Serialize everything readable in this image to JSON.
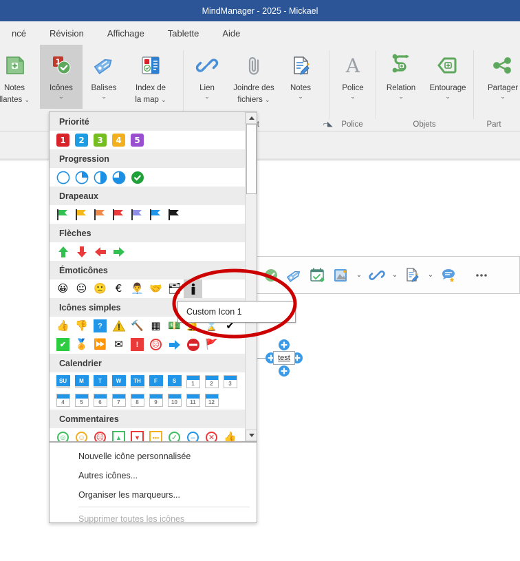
{
  "titlebar": {
    "title": "MindManager - 2025 - Mickael"
  },
  "tabs": [
    {
      "label": "ncé"
    },
    {
      "label": "Révision"
    },
    {
      "label": "Affichage"
    },
    {
      "label": "Tablette"
    },
    {
      "label": "Aide"
    }
  ],
  "ribbon": {
    "groups": [
      {
        "label": "e sujet",
        "buttons": [
          {
            "label": "Notes\nllantes",
            "icon": "floating-notes-icon",
            "chevron": true,
            "active": false
          },
          {
            "label": "Icônes",
            "icon": "icons-icon",
            "chevron": true,
            "active": true
          },
          {
            "label": "Balises",
            "icon": "tags-icon",
            "chevron": true,
            "active": false
          },
          {
            "label": "Index de\nla map",
            "icon": "map-index-icon",
            "chevron": true,
            "active": false
          },
          {
            "label": "Lien",
            "icon": "link-icon",
            "chevron": true,
            "active": false
          },
          {
            "label": "Joindre des\nfichiers",
            "icon": "attach-files-icon",
            "chevron": true,
            "active": false
          },
          {
            "label": "Notes",
            "icon": "notes-icon",
            "chevron": true,
            "active": false
          }
        ]
      },
      {
        "label": "Police",
        "buttons": [
          {
            "label": "Police",
            "icon": "font-icon",
            "chevron": true,
            "active": false
          }
        ]
      },
      {
        "label": "Objets",
        "buttons": [
          {
            "label": "Relation",
            "icon": "relation-icon",
            "chevron": true,
            "active": false
          },
          {
            "label": "Entourage",
            "icon": "boundary-icon",
            "chevron": true,
            "active": false
          }
        ]
      },
      {
        "label": "Part",
        "buttons": [
          {
            "label": "Partager",
            "icon": "share-icon",
            "chevron": true,
            "active": false
          }
        ]
      }
    ]
  },
  "icon_panel": {
    "sections": [
      {
        "heading": "Priorité",
        "rows": [
          [
            {
              "name": "priority-1",
              "kind": "num",
              "text": "1",
              "color": "#d8232a"
            },
            {
              "name": "priority-2",
              "kind": "num",
              "text": "2",
              "color": "#1b9ce3"
            },
            {
              "name": "priority-3",
              "kind": "num",
              "text": "3",
              "color": "#76bd22"
            },
            {
              "name": "priority-4",
              "kind": "num",
              "text": "4",
              "color": "#f2b01e"
            },
            {
              "name": "priority-5",
              "kind": "num",
              "text": "5",
              "color": "#9a4fd1"
            }
          ]
        ]
      },
      {
        "heading": "Progression",
        "rows": [
          [
            {
              "name": "progress-0",
              "kind": "pie",
              "pct": 0,
              "color": "#1b8fe3"
            },
            {
              "name": "progress-25",
              "kind": "pie",
              "pct": 25,
              "color": "#1b8fe3"
            },
            {
              "name": "progress-50",
              "kind": "pie",
              "pct": 50,
              "color": "#1b8fe3"
            },
            {
              "name": "progress-75",
              "kind": "pie",
              "pct": 75,
              "color": "#1b8fe3"
            },
            {
              "name": "progress-100",
              "kind": "check-circle",
              "color": "#1fa038"
            }
          ]
        ]
      },
      {
        "heading": "Drapeaux",
        "rows": [
          [
            {
              "name": "flag-green",
              "kind": "flag",
              "color": "#31c14e"
            },
            {
              "name": "flag-yellow",
              "kind": "flag",
              "color": "#f5b81b"
            },
            {
              "name": "flag-orange",
              "kind": "flag",
              "color": "#f08a4b"
            },
            {
              "name": "flag-red",
              "kind": "flag",
              "color": "#ea3a3a"
            },
            {
              "name": "flag-purple",
              "kind": "flag",
              "color": "#8f8fe8"
            },
            {
              "name": "flag-blue",
              "kind": "flag",
              "color": "#2196e8"
            },
            {
              "name": "flag-black",
              "kind": "flag",
              "color": "#1a1a1a"
            }
          ]
        ]
      },
      {
        "heading": "Flèches",
        "rows": [
          [
            {
              "name": "arrow-up",
              "kind": "arrow",
              "dir": "up",
              "color": "#31c14e"
            },
            {
              "name": "arrow-down",
              "kind": "arrow",
              "dir": "down",
              "color": "#ea3a3a"
            },
            {
              "name": "arrow-left",
              "kind": "arrow",
              "dir": "left",
              "color": "#ea3a3a"
            },
            {
              "name": "arrow-right",
              "kind": "arrow",
              "dir": "right",
              "color": "#31c14e"
            }
          ]
        ]
      },
      {
        "heading": "Émoticônes",
        "rows": [
          [
            {
              "name": "smiley-happy",
              "kind": "glyph",
              "text": "😀"
            },
            {
              "name": "smiley-neutral",
              "kind": "glyph",
              "text": "😐"
            },
            {
              "name": "smiley-sad",
              "kind": "glyph",
              "text": "🙁"
            },
            {
              "name": "euro-coin",
              "kind": "glyph",
              "text": "€"
            },
            {
              "name": "person-presenter",
              "kind": "glyph",
              "text": "👨‍💼"
            },
            {
              "name": "handshake-blue",
              "kind": "glyph",
              "text": "🤝"
            },
            {
              "name": "org-chart",
              "kind": "glyph",
              "text": "🗂"
            },
            {
              "name": "custom-icon-1",
              "kind": "person",
              "selected": true
            }
          ]
        ]
      },
      {
        "heading": "Icônes simples",
        "rows": [
          [
            {
              "name": "thumb-up",
              "kind": "glyph",
              "text": "👍"
            },
            {
              "name": "thumb-down",
              "kind": "glyph",
              "text": "👎"
            },
            {
              "name": "question",
              "kind": "sq",
              "text": "?",
              "color": "#2196e8"
            },
            {
              "name": "warning",
              "kind": "tri-warn",
              "color": "#f5c518"
            },
            {
              "name": "gavel",
              "kind": "glyph",
              "text": "🔨"
            },
            {
              "name": "spreadsheet",
              "kind": "glyph",
              "text": "▦"
            },
            {
              "name": "money",
              "kind": "glyph",
              "text": "💵"
            },
            {
              "name": "alarm-bell",
              "kind": "glyph",
              "text": "🔔"
            },
            {
              "name": "hourglass",
              "kind": "glyph",
              "text": "⌛"
            },
            {
              "name": "check-green",
              "kind": "glyph",
              "text": "✔"
            }
          ],
          [
            {
              "name": "checkbox-checked",
              "kind": "sq",
              "text": "✔",
              "color": "#2ecc40"
            },
            {
              "name": "medal",
              "kind": "glyph",
              "text": "🏅"
            },
            {
              "name": "double-arrow",
              "kind": "glyph",
              "text": "⏩"
            },
            {
              "name": "envelope",
              "kind": "glyph",
              "text": "✉"
            },
            {
              "name": "exclamation",
              "kind": "sq",
              "text": "!",
              "color": "#ea3a3a"
            },
            {
              "name": "frown-circle",
              "kind": "circ",
              "text": "☹",
              "color": "#ea3a3a"
            },
            {
              "name": "arrow-right-blue",
              "kind": "arrow",
              "dir": "right",
              "color": "#2196e8"
            },
            {
              "name": "no-entry",
              "kind": "noentry",
              "color": "#d8232a"
            },
            {
              "name": "flag-back-red",
              "kind": "glyph",
              "text": "🚩"
            }
          ]
        ]
      },
      {
        "heading": "Calendrier",
        "rows": [
          [
            {
              "name": "cal-su",
              "kind": "calday",
              "text": "SU"
            },
            {
              "name": "cal-m",
              "kind": "calday",
              "text": "M"
            },
            {
              "name": "cal-t",
              "kind": "calday",
              "text": "T"
            },
            {
              "name": "cal-w",
              "kind": "calday",
              "text": "W"
            },
            {
              "name": "cal-th",
              "kind": "calday",
              "text": "TH"
            },
            {
              "name": "cal-f",
              "kind": "calday",
              "text": "F"
            },
            {
              "name": "cal-s",
              "kind": "calday",
              "text": "S"
            },
            {
              "name": "cal-1",
              "kind": "calcell",
              "text": "1"
            },
            {
              "name": "cal-2",
              "kind": "calcell",
              "text": "2"
            },
            {
              "name": "cal-3",
              "kind": "calcell",
              "text": "3"
            }
          ],
          [
            {
              "name": "cal-4",
              "kind": "calcell",
              "text": "4"
            },
            {
              "name": "cal-5",
              "kind": "calcell",
              "text": "5"
            },
            {
              "name": "cal-6",
              "kind": "calcell",
              "text": "6"
            },
            {
              "name": "cal-7",
              "kind": "calcell",
              "text": "7"
            },
            {
              "name": "cal-8",
              "kind": "calcell",
              "text": "8"
            },
            {
              "name": "cal-9",
              "kind": "calcell",
              "text": "9"
            },
            {
              "name": "cal-10",
              "kind": "calcell",
              "text": "10"
            },
            {
              "name": "cal-11",
              "kind": "calcell",
              "text": "11"
            },
            {
              "name": "cal-12",
              "kind": "calcell",
              "text": "12"
            }
          ]
        ]
      },
      {
        "heading": "Commentaires",
        "rows": [
          [
            {
              "name": "comment-smile-green",
              "kind": "circ",
              "text": "☺",
              "color": "#3fbf5f"
            },
            {
              "name": "comment-neutral-yellow",
              "kind": "circ",
              "text": "☺",
              "color": "#f2b01e"
            },
            {
              "name": "comment-sad-red",
              "kind": "circ",
              "text": "☹",
              "color": "#ea3a3a"
            },
            {
              "name": "comment-up-green",
              "kind": "sqo",
              "text": "▲",
              "color": "#3fbf5f"
            },
            {
              "name": "comment-down-red",
              "kind": "sqo",
              "text": "▼",
              "color": "#ea3a3a"
            },
            {
              "name": "comment-dots-yellow",
              "kind": "sqo",
              "text": "•••",
              "color": "#f2b01e"
            },
            {
              "name": "comment-check-green",
              "kind": "circ",
              "text": "✓",
              "color": "#3fbf5f"
            },
            {
              "name": "comment-minus-blue",
              "kind": "circ",
              "text": "–",
              "color": "#2196e8"
            },
            {
              "name": "comment-cross-red",
              "kind": "circ",
              "text": "✕",
              "color": "#ea3a3a"
            },
            {
              "name": "comment-thumb-up",
              "kind": "glyph",
              "text": "👍"
            }
          ]
        ]
      }
    ]
  },
  "context_menu": {
    "items": [
      {
        "label": "Nouvelle icône personnalisée",
        "disabled": false,
        "separator_after": false
      },
      {
        "label": "Autres icônes...",
        "disabled": false,
        "separator_after": false
      },
      {
        "label": "Organiser les marqueurs...",
        "disabled": false,
        "separator_after": true
      },
      {
        "label": "Supprimer toutes les icônes",
        "disabled": true,
        "separator_after": false
      }
    ]
  },
  "tooltip": {
    "text": "Custom Icon 1"
  },
  "floating_toolbar": {
    "items": [
      {
        "name": "task-check-icon",
        "chevron": false
      },
      {
        "name": "tag-icon",
        "chevron": false
      },
      {
        "name": "calendar-task-icon",
        "chevron": false
      },
      {
        "name": "image-icon",
        "chevron": true
      },
      {
        "name": "hyperlink-icon",
        "chevron": true
      },
      {
        "name": "notes-icon",
        "chevron": true
      },
      {
        "name": "comment-icon",
        "chevron": false
      },
      {
        "name": "more-options-icon",
        "chevron": false
      }
    ]
  },
  "map": {
    "topic_label": "test"
  },
  "annotation": {
    "ellipse_color": "#cc0000"
  }
}
